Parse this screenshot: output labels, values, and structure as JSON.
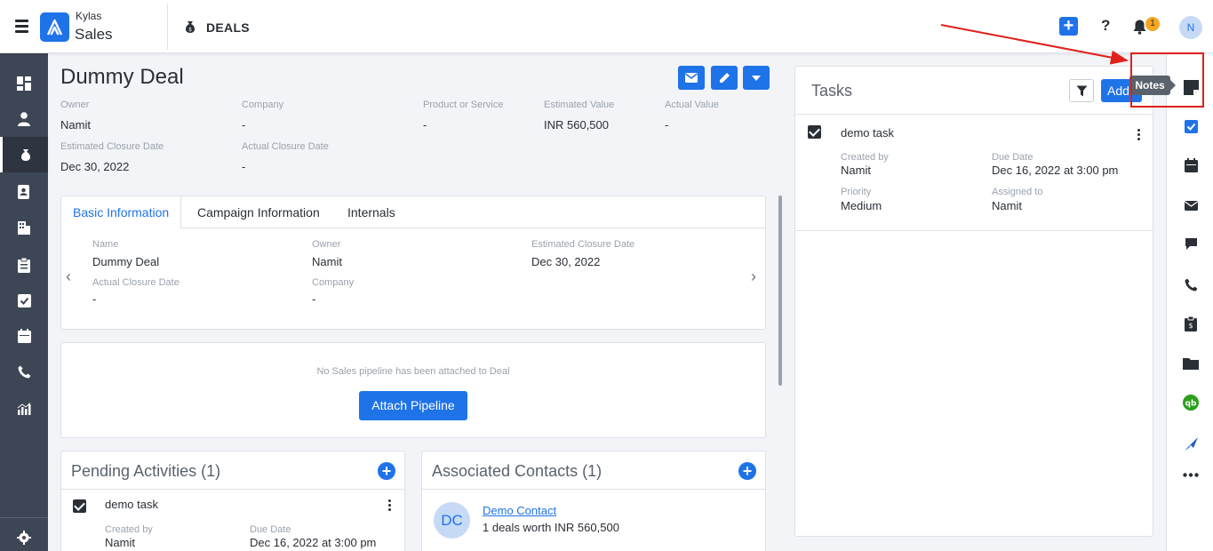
{
  "app": {
    "brand_top": "Kylas",
    "brand_bottom": "Sales",
    "module": "DEALS",
    "notification_count": "1",
    "user_initial": "N"
  },
  "deal": {
    "title": "Dummy Deal",
    "fields": [
      {
        "label": "Owner",
        "value": "Namit"
      },
      {
        "label": "Company",
        "value": "-"
      },
      {
        "label": "Product or Service",
        "value": "-"
      },
      {
        "label": "Estimated Value",
        "value": "INR 560,500"
      },
      {
        "label": "Actual Value",
        "value": "-"
      },
      {
        "label": "Estimated Closure Date",
        "value": "Dec 30, 2022"
      },
      {
        "label": "Actual Closure Date",
        "value": "-"
      }
    ]
  },
  "tabs": [
    "Basic Information",
    "Campaign Information",
    "Internals"
  ],
  "basic_info": [
    {
      "label": "Name",
      "value": "Dummy Deal"
    },
    {
      "label": "Owner",
      "value": "Namit"
    },
    {
      "label": "Estimated Closure Date",
      "value": "Dec 30, 2022"
    },
    {
      "label": "Actual Closure Date",
      "value": "-"
    },
    {
      "label": "Company",
      "value": "-"
    }
  ],
  "pipeline": {
    "message": "No Sales pipeline has been attached to Deal",
    "button": "Attach Pipeline"
  },
  "pending_activities": {
    "title": "Pending Activities (1)",
    "task": {
      "name": "demo task",
      "created_by_label": "Created by",
      "created_by": "Namit",
      "due_date_label": "Due Date",
      "due_date": "Dec 16, 2022 at 3:00 pm"
    }
  },
  "associated_contacts": {
    "title": "Associated Contacts (1)",
    "contact": {
      "initials": "DC",
      "name": "Demo Contact",
      "summary": "1 deals worth INR 560,500"
    }
  },
  "tasks_panel": {
    "title": "Tasks",
    "add_label": "Add",
    "task": {
      "name": "demo task",
      "created_by_label": "Created by",
      "created_by": "Namit",
      "due_date_label": "Due Date",
      "due_date": "Dec 16, 2022 at 3:00 pm",
      "priority_label": "Priority",
      "priority": "Medium",
      "assigned_to_label": "Assigned to",
      "assigned_to": "Namit"
    }
  },
  "tooltip": "Notes",
  "icons": {
    "left_nav": [
      "dashboard-icon",
      "contact-icon",
      "deal-money-bag-icon",
      "address-book-icon",
      "company-building-icon",
      "clipboard-icon",
      "task-check-icon",
      "calendar-icon",
      "phone-icon",
      "reports-chart-icon",
      "settings-gear-icon"
    ],
    "right_strip": [
      "notes-icon",
      "task-check-icon",
      "calendar-icon",
      "email-icon",
      "chat-icon",
      "phone-icon",
      "clipboard-dollar-icon",
      "folder-icon",
      "quickbooks-icon",
      "kylas-rocket-icon",
      "more-icon"
    ]
  },
  "colors": {
    "primary": "#1f73e8",
    "nav_bg": "#3d4654",
    "annotation": "#e0201b",
    "badge": "#f5a623"
  }
}
